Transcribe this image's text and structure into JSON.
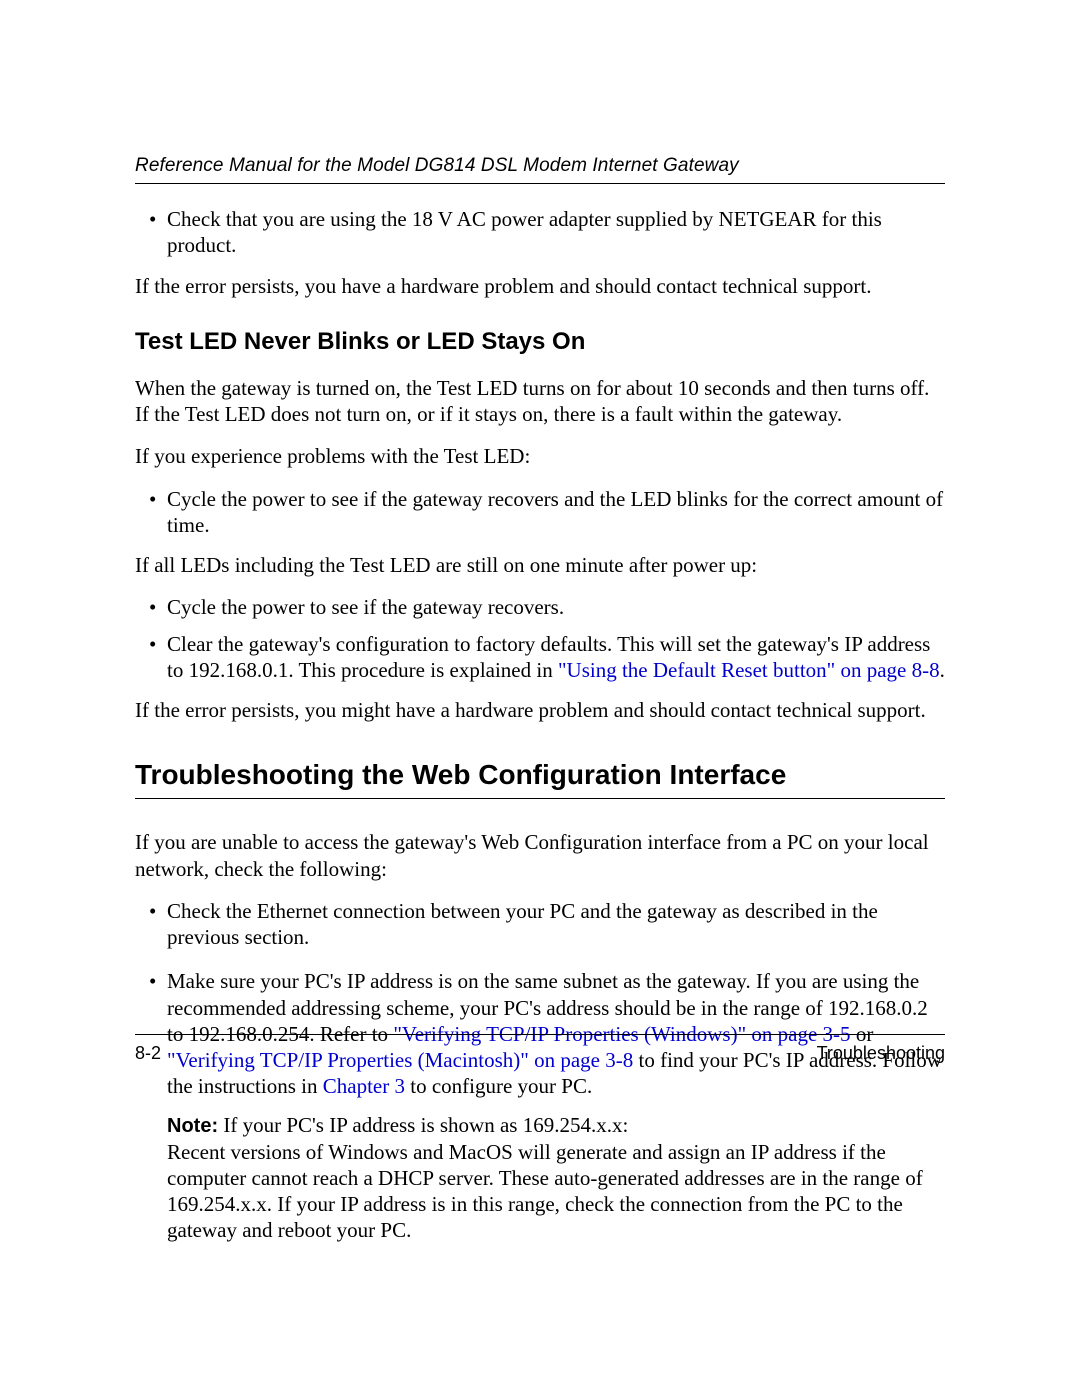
{
  "header": {
    "running_title": "Reference Manual for the Model DG814 DSL Modem Internet Gateway"
  },
  "intro": {
    "bullet1": "Check that you are using the 18 V AC power adapter supplied by NETGEAR for this product.",
    "para1": "If the error persists, you have a hardware problem and should contact technical support."
  },
  "section1": {
    "heading": "Test LED Never Blinks or LED Stays On",
    "para1": "When the gateway is turned on, the Test LED turns on for about 10 seconds and then turns off. If the Test LED does not turn on, or if it stays on, there is a fault within the gateway.",
    "para2": "If you experience problems with the Test LED:",
    "bullets1": {
      "b1": "Cycle the power to see if the gateway recovers and the LED blinks for the correct amount of time."
    },
    "para3": "If all LEDs including the Test LED are still on one minute after power up:",
    "bullets2": {
      "b1": "Cycle the power to see if the gateway recovers.",
      "b2_a": "Clear the gateway's configuration to factory defaults. This will set the gateway's IP address to 192.168.0.1. This procedure is explained in ",
      "b2_link": "\"Using the Default Reset button\" on page 8-8",
      "b2_c": "."
    },
    "para4": "If the error persists, you might have a hardware problem and should contact technical support."
  },
  "section2": {
    "heading": "Troubleshooting the Web Configuration Interface",
    "para1": "If you are unable to access the gateway's Web Configuration interface from a PC on your local network, check the following:",
    "bullets": {
      "b1": "Check the Ethernet connection between your PC and the gateway as described in the previous section.",
      "b2_a": "Make sure your PC's IP address is on the same subnet as the gateway. If you are using the recommended addressing scheme, your PC's address should be in the range of 192.168.0.2 to 192.168.0.254. Refer to ",
      "b2_link1": "\"Verifying TCP/IP Properties (Windows)\" on page 3-5",
      "b2_b": " or ",
      "b2_link2": "\"Verifying TCP/IP Properties (Macintosh)\" on page 3-8",
      "b2_c": " to find your PC's IP address. Follow the instructions in ",
      "b2_link3": "Chapter 3",
      "b2_d": " to configure your PC."
    },
    "note": {
      "label": "Note:",
      "first_line_rest": " If your PC's IP address is shown as 169.254.x.x:",
      "rest": "Recent versions of Windows and MacOS will generate and assign an IP address if the computer cannot reach a DHCP server. These auto-generated addresses are in the range of 169.254.x.x. If your IP address is in this range, check the connection from the PC to the gateway and reboot your PC."
    }
  },
  "footer": {
    "page_number": "8-2",
    "section_name": "Troubleshooting"
  }
}
